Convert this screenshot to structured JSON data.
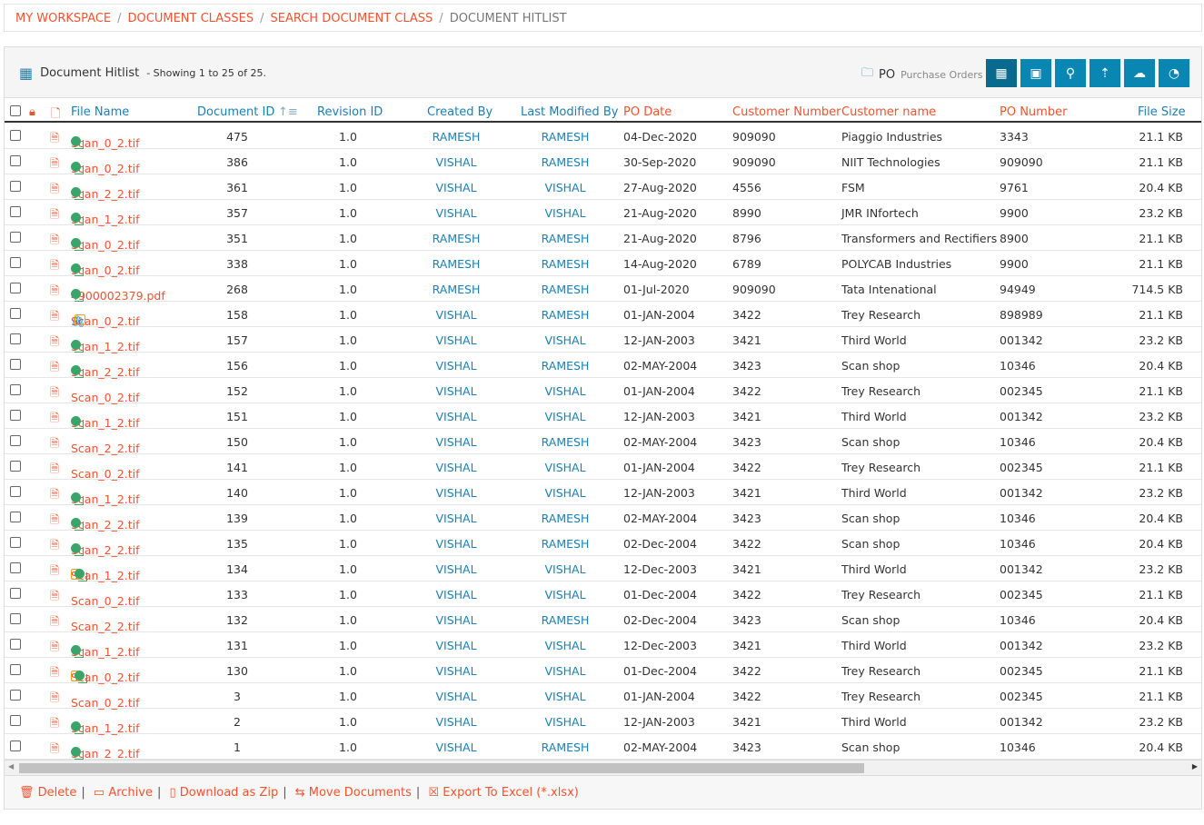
{
  "breadcrumb": [
    "MY WORKSPACE",
    "DOCUMENT CLASSES",
    "SEARCH DOCUMENT CLASS",
    "DOCUMENT HITLIST"
  ],
  "panel": {
    "title": "Document Hitlist",
    "showing": "- Showing 1 to 25 of 25.",
    "class_code": "PO",
    "class_name": "Purchase Orders",
    "toolbar": [
      "grid-icon",
      "image-icon",
      "binoculars-icon",
      "upload-file-icon",
      "cloud-upload-icon",
      "dashboard-icon"
    ]
  },
  "columns": {
    "file_name": "File Name",
    "document_id": "Document ID",
    "revision_id": "Revision ID",
    "created_by": "Created By",
    "last_modified_by": "Last Modified By",
    "po_date": "PO Date",
    "customer_number": "Customer Number",
    "customer_name": "Customer name",
    "po_number": "PO Number",
    "file_size": "File Size"
  },
  "rows": [
    [
      "Scan_0_2.tif",
      "g",
      "475",
      "1.0",
      "RAMESH",
      "RAMESH",
      "04-Dec-2020",
      "909090",
      "Piaggio Industries",
      "3343",
      "21.1 KB"
    ],
    [
      "Scan_0_2.tif",
      "g",
      "386",
      "1.0",
      "VISHAL",
      "RAMESH",
      "30-Sep-2020",
      "909090",
      "NIIT Technologies",
      "909090",
      "21.1 KB"
    ],
    [
      "Scan_2_2.tif",
      "g",
      "361",
      "1.0",
      "VISHAL",
      "VISHAL",
      "27-Aug-2020",
      "4556",
      "FSM",
      "9761",
      "20.4 KB"
    ],
    [
      "Scan_1_2.tif",
      "g",
      "357",
      "1.0",
      "VISHAL",
      "VISHAL",
      "21-Aug-2020",
      "8990",
      "JMR INfortech",
      "9900",
      "23.2 KB"
    ],
    [
      "Scan_0_2.tif",
      "g",
      "351",
      "1.0",
      "RAMESH",
      "RAMESH",
      "21-Aug-2020",
      "8796",
      "Transformers and Rectifiers",
      "8900",
      "21.1 KB"
    ],
    [
      "Scan_0_2.tif",
      "g",
      "338",
      "1.0",
      "RAMESH",
      "RAMESH",
      "14-Aug-2020",
      "6789",
      "POLYCAB Industries",
      "9900",
      "21.1 KB"
    ],
    [
      "4900002379.pdf",
      "g",
      "268",
      "1.0",
      "RAMESH",
      "RAMESH",
      "01-Jul-2020",
      "909090",
      "Tata Intenational",
      "94949",
      "714.5 KB"
    ],
    [
      "Scan_0_2.tif",
      "cn",
      "158",
      "1.0",
      "VISHAL",
      "RAMESH",
      "01-JAN-2004",
      "3422",
      "Trey Research",
      "898989",
      "21.1 KB"
    ],
    [
      "Scan_1_2.tif",
      "g",
      "157",
      "1.0",
      "VISHAL",
      "VISHAL",
      "12-JAN-2003",
      "3421",
      "Third World",
      "001342",
      "23.2 KB"
    ],
    [
      "Scan_2_2.tif",
      "g",
      "156",
      "1.0",
      "VISHAL",
      "RAMESH",
      "02-MAY-2004",
      "3423",
      "Scan shop",
      "10346",
      "20.4 KB"
    ],
    [
      "Scan_0_2.tif",
      "",
      "152",
      "1.0",
      "VISHAL",
      "VISHAL",
      "01-JAN-2004",
      "3422",
      "Trey Research",
      "002345",
      "21.1 KB"
    ],
    [
      "Scan_1_2.tif",
      "g",
      "151",
      "1.0",
      "VISHAL",
      "VISHAL",
      "12-JAN-2003",
      "3421",
      "Third World",
      "001342",
      "23.2 KB"
    ],
    [
      "Scan_2_2.tif",
      "",
      "150",
      "1.0",
      "VISHAL",
      "RAMESH",
      "02-MAY-2004",
      "3423",
      "Scan shop",
      "10346",
      "20.4 KB"
    ],
    [
      "Scan_0_2.tif",
      "",
      "141",
      "1.0",
      "VISHAL",
      "VISHAL",
      "01-JAN-2004",
      "3422",
      "Trey Research",
      "002345",
      "21.1 KB"
    ],
    [
      "Scan_1_2.tif",
      "g",
      "140",
      "1.0",
      "VISHAL",
      "VISHAL",
      "12-JAN-2003",
      "3421",
      "Third World",
      "001342",
      "23.2 KB"
    ],
    [
      "Scan_2_2.tif",
      "g",
      "139",
      "1.0",
      "VISHAL",
      "RAMESH",
      "02-MAY-2004",
      "3423",
      "Scan shop",
      "10346",
      "20.4 KB"
    ],
    [
      "Scan_2_2.tif",
      "g",
      "135",
      "1.0",
      "VISHAL",
      "RAMESH",
      "02-Dec-2004",
      "3422",
      "Scan shop",
      "10346",
      "20.4 KB"
    ],
    [
      "Scan_1_2.tif",
      "ng",
      "134",
      "1.0",
      "VISHAL",
      "VISHAL",
      "12-Dec-2003",
      "3421",
      "Third World",
      "001342",
      "23.2 KB"
    ],
    [
      "Scan_0_2.tif",
      "",
      "133",
      "1.0",
      "VISHAL",
      "VISHAL",
      "01-Dec-2004",
      "3422",
      "Trey Research",
      "002345",
      "21.1 KB"
    ],
    [
      "Scan_2_2.tif",
      "",
      "132",
      "1.0",
      "VISHAL",
      "RAMESH",
      "02-Dec-2004",
      "3423",
      "Scan shop",
      "10346",
      "20.4 KB"
    ],
    [
      "Scan_1_2.tif",
      "g",
      "131",
      "1.0",
      "VISHAL",
      "VISHAL",
      "12-Dec-2003",
      "3421",
      "Third World",
      "001342",
      "23.2 KB"
    ],
    [
      "Scan_0_2.tif",
      "ng",
      "130",
      "1.0",
      "VISHAL",
      "VISHAL",
      "01-Dec-2004",
      "3422",
      "Trey Research",
      "002345",
      "21.1 KB"
    ],
    [
      "Scan_0_2.tif",
      "",
      "3",
      "1.0",
      "VISHAL",
      "VISHAL",
      "01-JAN-2004",
      "3422",
      "Trey Research",
      "002345",
      "21.1 KB"
    ],
    [
      "Scan_1_2.tif",
      "g",
      "2",
      "1.0",
      "VISHAL",
      "VISHAL",
      "12-JAN-2003",
      "3421",
      "Third World",
      "001342",
      "23.2 KB"
    ],
    [
      "Scan_2_2.tif",
      "g",
      "1",
      "1.0",
      "VISHAL",
      "RAMESH",
      "02-MAY-2004",
      "3423",
      "Scan shop",
      "10346",
      "20.4 KB"
    ]
  ],
  "footer": {
    "delete": "Delete",
    "archive": "Archive",
    "zip": "Download as Zip",
    "move": "Move Documents",
    "excel": "Export To Excel (*.xlsx)"
  },
  "colors": {
    "accent": "#0a86b3",
    "link": "#1a7fb5",
    "red": "#f0522f"
  }
}
